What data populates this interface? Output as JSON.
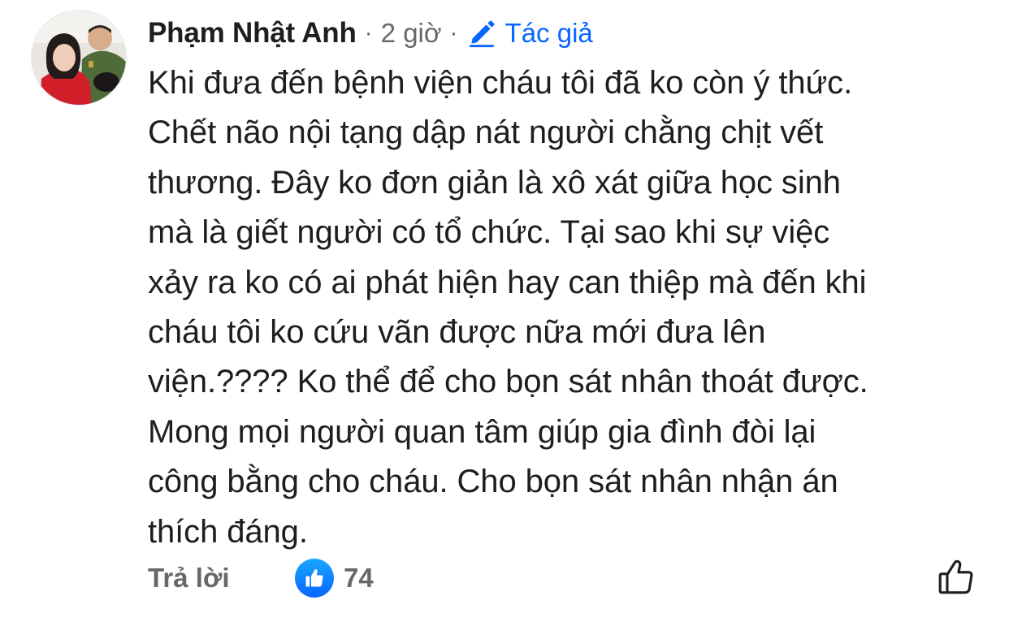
{
  "comment": {
    "author": "Phạm Nhật Anh",
    "separator": "·",
    "time": "2 giờ",
    "author_badge": "Tác giả",
    "body": "Khi đưa đến bệnh viện cháu tôi đã ko còn ý thức.\nChết não nội tạng dập nát người chằng chịt vết\nthương. Đây ko đơn giản là xô xát giữa học sinh\nmà là giết người có tổ chức. Tại sao khi sự việc\nxảy ra ko có ai phát hiện hay can thiệp mà đến khi\ncháu tôi ko cứu vãn được nữa mới đưa lên\nviện.???? Ko thể để cho bọn sát nhân thoát được.\nMong mọi người quan tâm giúp gia đình đòi lại\ncông bằng cho cháu. Cho bọn sát nhân nhận án\nthích đáng.",
    "reply_label": "Trả lời",
    "like_count": "74",
    "icons": {
      "badge": "pencil-icon",
      "reaction": "like-reaction-icon",
      "like_button": "thumbs-up-icon"
    },
    "colors": {
      "text": "#1c1e21",
      "secondary": "#65676b",
      "accent": "#0866ff"
    }
  }
}
